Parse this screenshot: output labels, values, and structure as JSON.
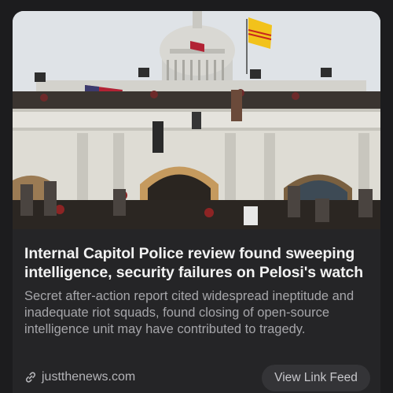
{
  "card": {
    "image_alt_icon": "news-photo",
    "headline": "Internal Capitol Police review found sweeping intelligence, security failures on Pelosi's watch",
    "summary": "Secret after-action report cited widespread ineptitude and inadequate riot squads, found closing of open-source intelligence unit may have contributed to tragedy.",
    "source": "justthenews.com",
    "source_icon": "link-icon",
    "button_label": "View Link Feed"
  },
  "colors": {
    "background": "#1c1c1e",
    "card": "#252527",
    "headline": "#f2f2f2",
    "summary": "#a6a6aa",
    "button_bg": "#343437"
  }
}
